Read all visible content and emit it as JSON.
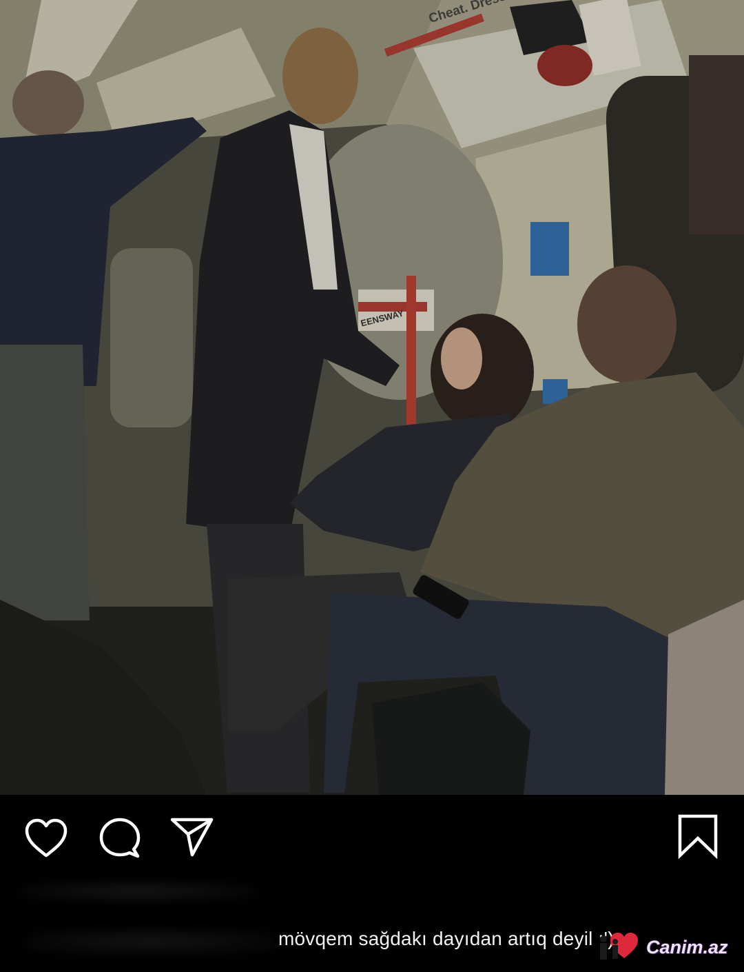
{
  "photo": {
    "ad_text": "Cheat. Dress better.",
    "station_text": "EENSWAY"
  },
  "actions": {
    "like": "heart-icon",
    "comment": "comment-icon",
    "share": "share-icon",
    "save": "bookmark-icon"
  },
  "caption": {
    "text": "mövqem sağdakı dayıdan artıq deyil :')"
  },
  "watermark": {
    "text": "Canim.az",
    "accent": "#e0283c"
  }
}
